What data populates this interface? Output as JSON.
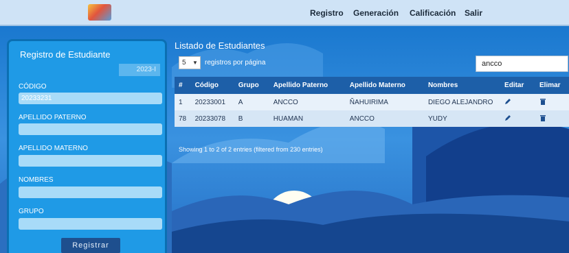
{
  "header": {
    "logo_icon": "school-logo-icon",
    "logo_text": "",
    "nav": [
      "Registro",
      "Generación",
      "Calificación",
      "Salir"
    ]
  },
  "form": {
    "title": "Registro de Estudiante",
    "period": "2023-I",
    "fields": [
      {
        "label": "CÓDIGO",
        "value": "20233231"
      },
      {
        "label": "APELLIDO PATERNO",
        "value": ""
      },
      {
        "label": "APELLIDO MATERNO",
        "value": ""
      },
      {
        "label": "NOMBRES",
        "value": ""
      },
      {
        "label": "GRUPO",
        "value": ""
      }
    ],
    "submit_label": "Registrar"
  },
  "list": {
    "title": "Listado de Estudiantes",
    "per_page": "5",
    "per_page_label": "registros por página",
    "search_value": "ancco",
    "columns": [
      "#",
      "Código",
      "Grupo",
      "Apellido Paterno",
      "Apellido Materno",
      "Nombres",
      "Editar",
      "Elimar"
    ],
    "rows": [
      [
        "1",
        "20233001",
        "A",
        "ANCCO",
        "ÑAHUIRIMA",
        "DIEGO ALEJANDRO"
      ],
      [
        "78",
        "20233078",
        "B",
        "HUAMAN",
        "ANCCO",
        "YUDY"
      ]
    ],
    "info": "Showing 1 to 2 of 2 entries (filtered from 230 entries)"
  },
  "colors": {
    "header_bg": "#cfe3f6",
    "panel_bg": "#1f9ae6",
    "table_header": "#1d5fa8",
    "submit_bg": "#1e4f8e"
  }
}
